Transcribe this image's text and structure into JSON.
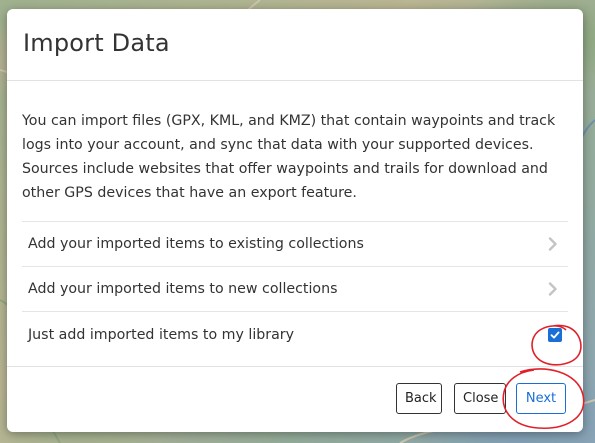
{
  "dialog": {
    "title": "Import Data",
    "intro": "You can import files (GPX, KML, and KMZ) that contain waypoints and track logs into your account, and sync that data with your supported devices. Sources include websites that offer waypoints and trails for download and other GPS devices that have an export feature."
  },
  "options": [
    {
      "label": "Add your imported items to existing collections",
      "control": "chevron-right-icon"
    },
    {
      "label": "Add your imported items to new collections",
      "control": "chevron-right-icon"
    },
    {
      "label": "Just add imported items to my library",
      "control": "checkbox",
      "checked": true
    }
  ],
  "footer": {
    "back_label": "Back",
    "close_label": "Close",
    "next_label": "Next"
  },
  "colors": {
    "accent": "#1a6fd6",
    "annotation": "#e0202a"
  }
}
